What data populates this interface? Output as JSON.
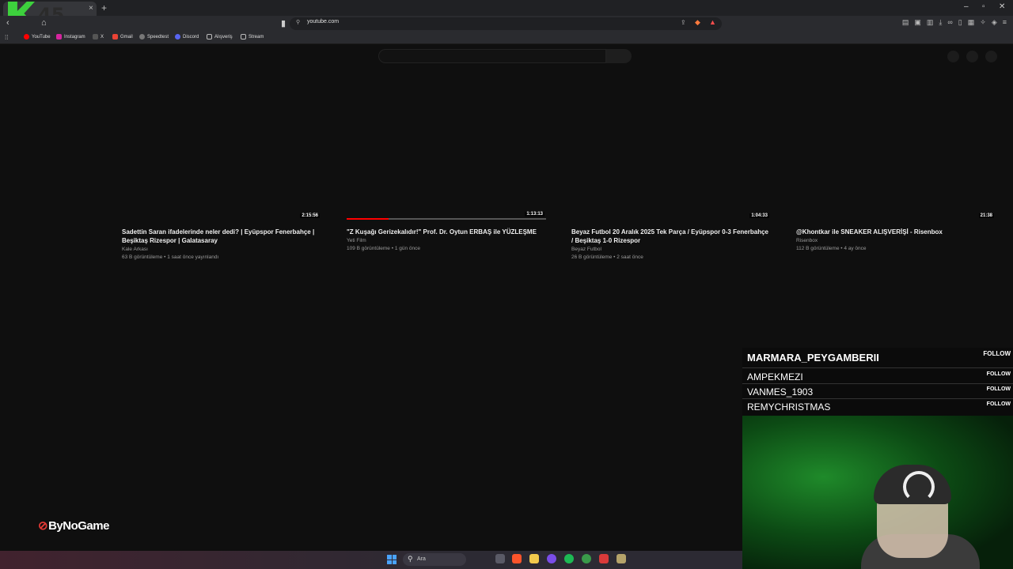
{
  "browser": {
    "tab_close": "×",
    "new_tab": "+",
    "logo_number": "45",
    "url": "youtube.com",
    "bookmarks": [
      "YouTube",
      "Instagram",
      "X",
      "Gmail",
      "Speedtest",
      "Discord",
      "Alışveriş",
      "Stream"
    ]
  },
  "videos": [
    {
      "title": "Sadettin Saran ifadelerinde neler dedi? | Eyüpspor Fenerbahçe | Beşiktaş Rizespor | Galatasaray",
      "channel": "Kale Arkası",
      "meta": "63 B görüntüleme • 1 saat önce yayınlandı",
      "duration": "2:15:56",
      "watched": 0
    },
    {
      "title": "\"Z Kuşağı Gerizekalıdır!\" Prof. Dr. Oytun ERBAŞ ile YÜZLEŞME",
      "channel": "Yeti Film",
      "meta": "109 B görüntüleme • 1 gün önce",
      "duration": "1:13:13",
      "watched": 0.21
    },
    {
      "title": "Beyaz Futbol 20 Aralık 2025 Tek Parça / Eyüpspor 0-3 Fenerbahçe / Beşiktaş 1-0 Rizespor",
      "channel": "Beyaz Futbol",
      "meta": "26 B görüntüleme • 2 saat önce",
      "duration": "1:04:33",
      "watched": 0
    },
    {
      "title": "@Khontkar  ile SNEAKER ALIŞVERİŞİ - Risenbox",
      "channel": "Risenbox",
      "meta": "112 B görüntüleme • 4 ay önce",
      "duration": "21:38",
      "watched": 0
    }
  ],
  "overlay": {
    "brand": "ByNoGame",
    "followers": [
      {
        "name": "MARMARA_PEYGAMBERII",
        "tag": "FOLLOW"
      },
      {
        "name": "AMPEKMEZI",
        "tag": "FOLLOW"
      },
      {
        "name": "VANMES_1903",
        "tag": "FOLLOW"
      },
      {
        "name": "REMYCHRISTMAS",
        "tag": "FOLLOW"
      }
    ]
  },
  "taskbar": {
    "search_placeholder": "Ara"
  },
  "colors": {
    "background": "#0f0f0f",
    "progress": "#ff0000",
    "logo": "#3dd13d"
  }
}
